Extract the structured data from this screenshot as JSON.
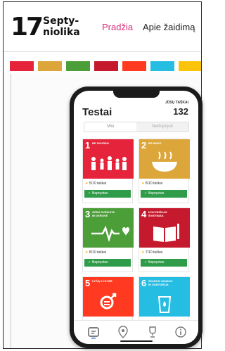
{
  "header": {
    "logo_number": "17",
    "logo_word_1": "Septy-",
    "logo_word_2": "niolika",
    "nav": [
      {
        "label": "Pradžia"
      },
      {
        "label": "Apie žaidimą"
      }
    ],
    "active_color": "#d6307a"
  },
  "stripe_colors": [
    "#e5243b",
    "#dda63a",
    "#4c9f38",
    "#c5192d",
    "#ff3a21",
    "#26bde2",
    "#fcc30b",
    "#a21942"
  ],
  "app": {
    "title": "Testai",
    "score_label": "JŪSŲ TAŠKAI",
    "score_value": "132",
    "tabs": [
      {
        "label": "Visi"
      },
      {
        "label": "Neišspręsti"
      }
    ],
    "cards": [
      {
        "number": "1",
        "name": "Be skurdo",
        "score": "5/10 taškai",
        "status": "Išspręstas",
        "color": "#e5243b",
        "icon": "people-icon"
      },
      {
        "number": "2",
        "name": "Be bado",
        "score": "8/10 taškai",
        "status": "Išspręstas",
        "color": "#dda63a",
        "icon": "bowl-icon"
      },
      {
        "number": "3",
        "name": "Gera sveikata ir gerovė",
        "score": "8/10 taškai",
        "status": "Išspręstas",
        "color": "#4c9f38",
        "icon": "heartbeat-icon"
      },
      {
        "number": "4",
        "name": "Kokybiškas švietimas",
        "score": "7/10 taškai",
        "status": "Išspręstas",
        "color": "#c5192d",
        "icon": "book-icon"
      },
      {
        "number": "5",
        "name": "Lyčių lygybė",
        "score": "",
        "status": "",
        "color": "#ff3a21",
        "icon": "gender-icon"
      },
      {
        "number": "6",
        "name": "Švarus vanduo ir sanitarija",
        "score": "",
        "status": "",
        "color": "#26bde2",
        "icon": "water-icon"
      }
    ],
    "tabbar": [
      "quiz-icon",
      "map-pin-icon",
      "trophy-icon",
      "info-icon"
    ]
  }
}
